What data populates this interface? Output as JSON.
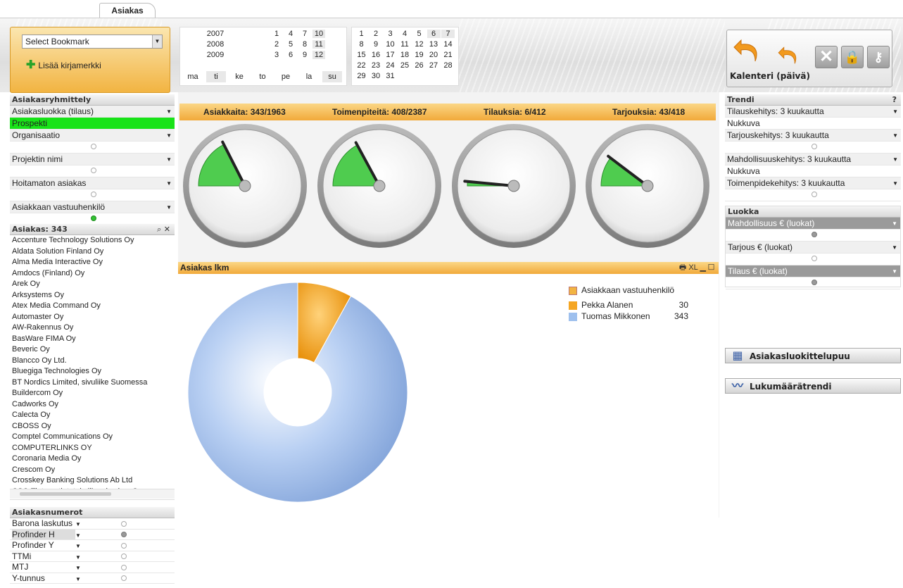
{
  "tabs": [
    {
      "label": "Asiakas"
    }
  ],
  "bookmark": {
    "select_label": "Select Bookmark",
    "add_label": "Lisää kirjamerkki"
  },
  "years": [
    "2007",
    "2008",
    "2009"
  ],
  "months": [
    "1",
    "4",
    "7",
    "10",
    "2",
    "5",
    "8",
    "11",
    "3",
    "6",
    "9",
    "12"
  ],
  "weekdays": [
    "ma",
    "ti",
    "ke",
    "to",
    "pe",
    "la",
    "su"
  ],
  "days": [
    "1",
    "2",
    "3",
    "4",
    "5",
    "6",
    "7",
    "8",
    "9",
    "10",
    "11",
    "12",
    "13",
    "14",
    "15",
    "16",
    "17",
    "18",
    "19",
    "20",
    "21",
    "22",
    "23",
    "24",
    "25",
    "26",
    "27",
    "28",
    "29",
    "30",
    "31"
  ],
  "toolbar_right": {
    "calendar_label": "Kalenteri (päivä)",
    "icons": [
      "undo-icon",
      "redo-icon",
      "clear-icon",
      "lock-icon",
      "unlock-icon"
    ]
  },
  "grouping": {
    "title": "Asiakasryhmittely",
    "rows": [
      {
        "label": "Asiakasluokka (tilaus)",
        "value": "Prospekti"
      },
      {
        "label": "Organisaatio"
      },
      {
        "label": "Projektin nimi"
      },
      {
        "label": "Hoitamaton asiakas"
      },
      {
        "label": "Asiakkaan vastuuhenkilö"
      }
    ]
  },
  "customers": {
    "title": "Asiakas: 343",
    "items": [
      "Accenture Technology Solutions Oy",
      "Aldata Solution Finland Oy",
      "Alma Media Interactive Oy",
      "Amdocs (Finland) Oy",
      "Arek Oy",
      "Arksystems Oy",
      "Atex Media Command Oy",
      "Automaster Oy",
      "AW-Rakennus Oy",
      "BasWare FIMA Oy",
      "Beveric Oy",
      "Blancco Oy Ltd.",
      "Bluegiga Technologies Oy",
      "BT Nordics Limited, sivuliike Suomessa",
      "Buildercom Oy",
      "Cadworks Oy",
      "Calecta Oy",
      "CBOSS Oy",
      "Comptel Communications Oy",
      "COMPUTERLINKS OY",
      "Coronaria Media Oy",
      "Crescom Oy",
      "Crosskey Banking Solutions Ab Ltd",
      "CSC-Tieteen tietotekniikan keskus Oy"
    ]
  },
  "numbers": {
    "title": "Asiakasnumerot",
    "rows": [
      "Barona laskutus",
      "Profinder H",
      "Profinder Y",
      "TTMi",
      "MTJ",
      "Y-tunnus"
    ]
  },
  "kpi": {
    "labels": [
      "Asiakkaita: 343/1963",
      "Toimenpiteitä: 408/2387",
      "Tilauksia: 6/412",
      "Tarjouksia: 43/418"
    ],
    "values": [
      0.175,
      0.171,
      0.015,
      0.103
    ]
  },
  "chart_header": {
    "title": "Asiakas lkm",
    "icons": [
      "print-icon",
      "excel-icon",
      "minimize-icon",
      "maximize-icon"
    ],
    "excel_label": "XL"
  },
  "chart_data": {
    "type": "pie",
    "title": "Asiakas lkm",
    "legend_title": "Asiakkaan vastuuhenkilö",
    "slices": [
      {
        "label": "Pekka Alanen",
        "value": 30,
        "color": "#f5a623"
      },
      {
        "label": "Tuomas Mikkonen",
        "value": 343,
        "color": "#9ec0ee"
      }
    ]
  },
  "trend": {
    "title": "Trendi",
    "help": "?",
    "rows": [
      {
        "label": "Tilauskehitys: 3 kuukautta",
        "value": "Nukkuva"
      },
      {
        "label": "Tarjouskehitys: 3 kuukautta"
      },
      {
        "label": "Mahdollisuuskehitys: 3 kuukautta",
        "value": "Nukkuva"
      },
      {
        "label": "Toimenpidekehitys: 3 kuukautta"
      }
    ]
  },
  "class": {
    "title": "Luokka",
    "rows": [
      "Mahdollisuus € (luokat)",
      "Tarjous € (luokat)",
      "Tilaus € (luokat)"
    ]
  },
  "side_buttons": [
    "Asiakasluokittelupuu",
    "Lukumäärätrendi"
  ]
}
